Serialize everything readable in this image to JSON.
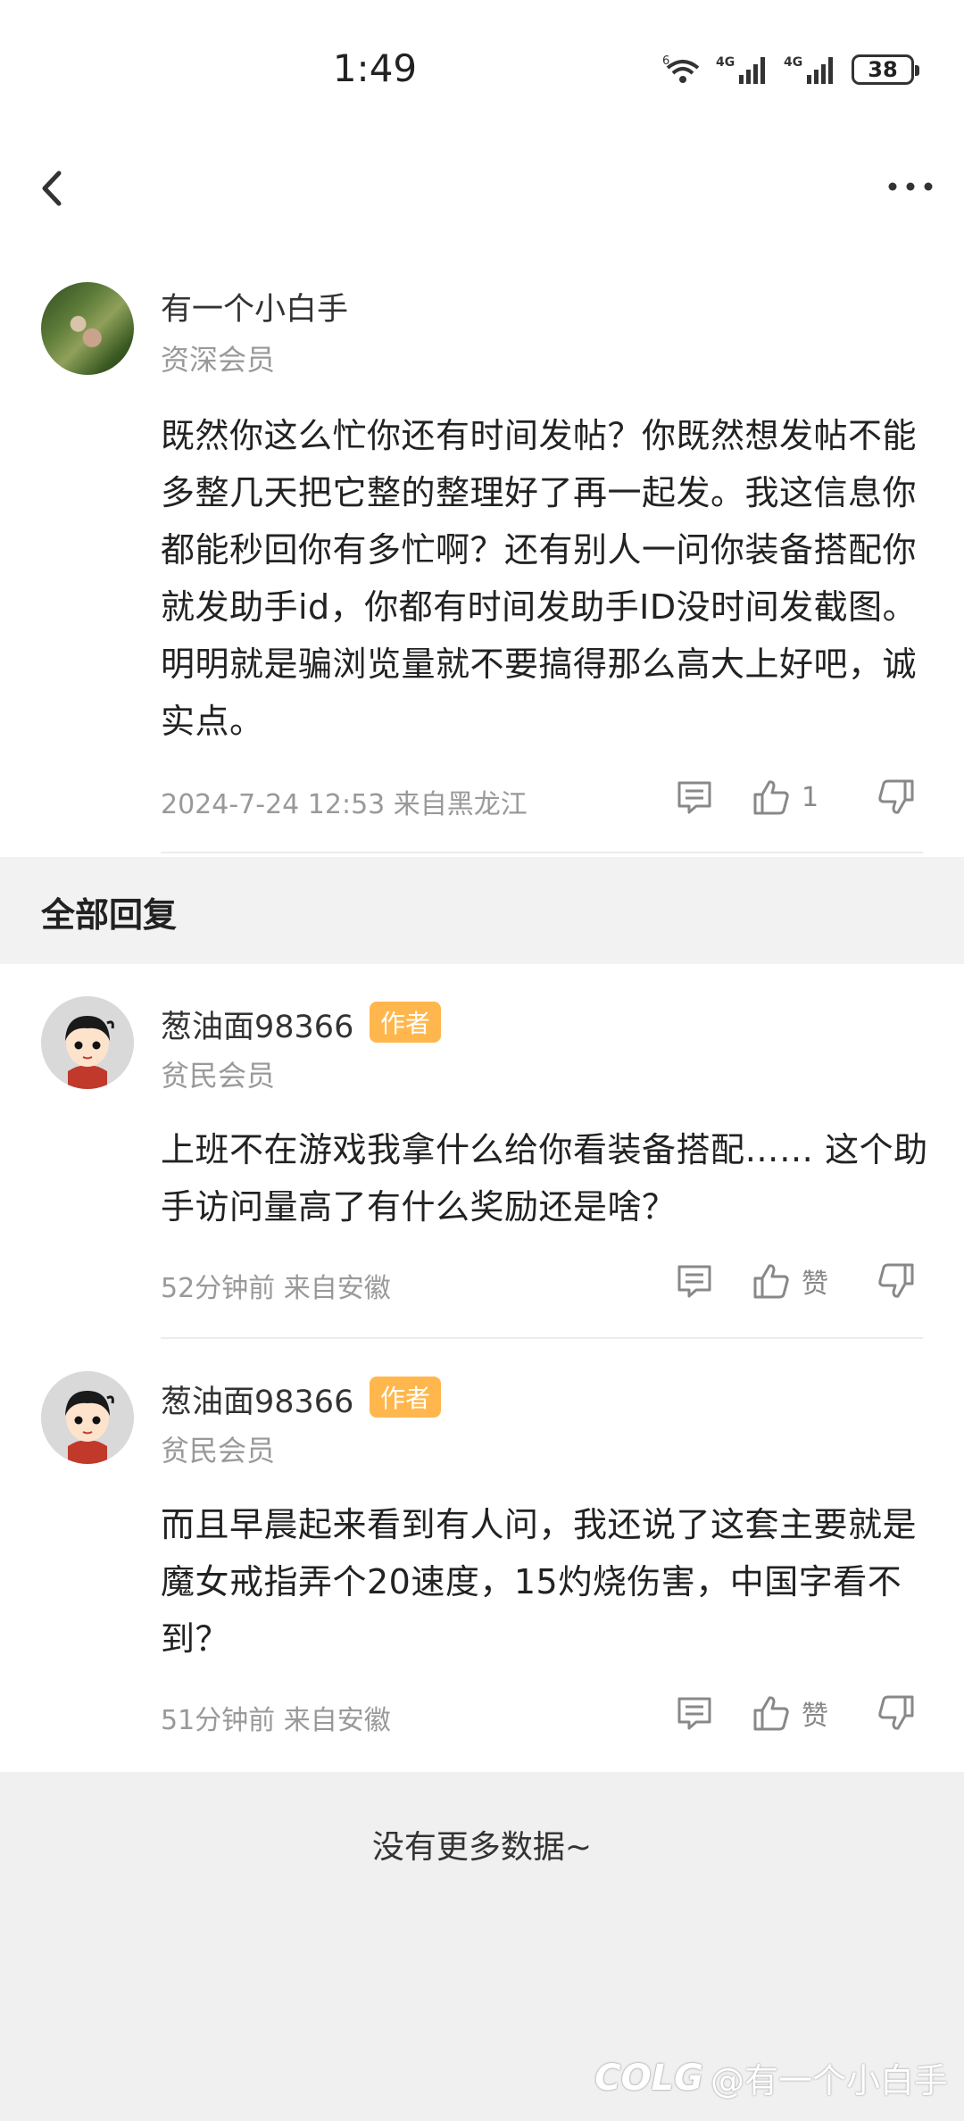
{
  "status_bar": {
    "time": "1:49",
    "battery": "38",
    "signal_label": "4G"
  },
  "post": {
    "username": "有一个小白手",
    "member_level": "资深会员",
    "content": "既然你这么忙你还有时间发帖？你既然想发帖不能多整几天把它整的整理好了再一起发。我这信息你都能秒回你有多忙啊？还有别人一问你装备搭配你就发助手id，你都有时间发助手ID没时间发截图。明明就是骗浏览量就不要搞得那么高大上好吧，诚实点。",
    "meta": "2024-7-24 12:53  来自黑龙江",
    "like_count": "1"
  },
  "replies_header": "全部回复",
  "replies": [
    {
      "username": "葱油面98366",
      "badge": "作者",
      "member_level": "贫民会员",
      "content": "上班不在游戏我拿什么给你看装备搭配…… 这个助手访问量高了有什么奖励还是啥？",
      "meta": "52分钟前  来自安徽",
      "like_label": "赞"
    },
    {
      "username": "葱油面98366",
      "badge": "作者",
      "member_level": "贫民会员",
      "content": "而且早晨起来看到有人问，我还说了这套主要就是魔女戒指弄个20速度，15灼烧伤害，中国字看不到？",
      "meta": "51分钟前  来自安徽",
      "like_label": "赞"
    }
  ],
  "footer": {
    "no_more": "没有更多数据~",
    "watermark_logo": "COLG",
    "watermark_user": "@有一个小白手"
  },
  "colors": {
    "badge": "#ffb74d",
    "background": "#f0f0f0",
    "card": "#ffffff",
    "meta_text": "#999999"
  },
  "icons": [
    "back-icon",
    "more-icon",
    "wifi-icon",
    "signal-icon",
    "battery-icon",
    "comment-icon",
    "thumbs-up-icon",
    "thumbs-down-icon"
  ]
}
